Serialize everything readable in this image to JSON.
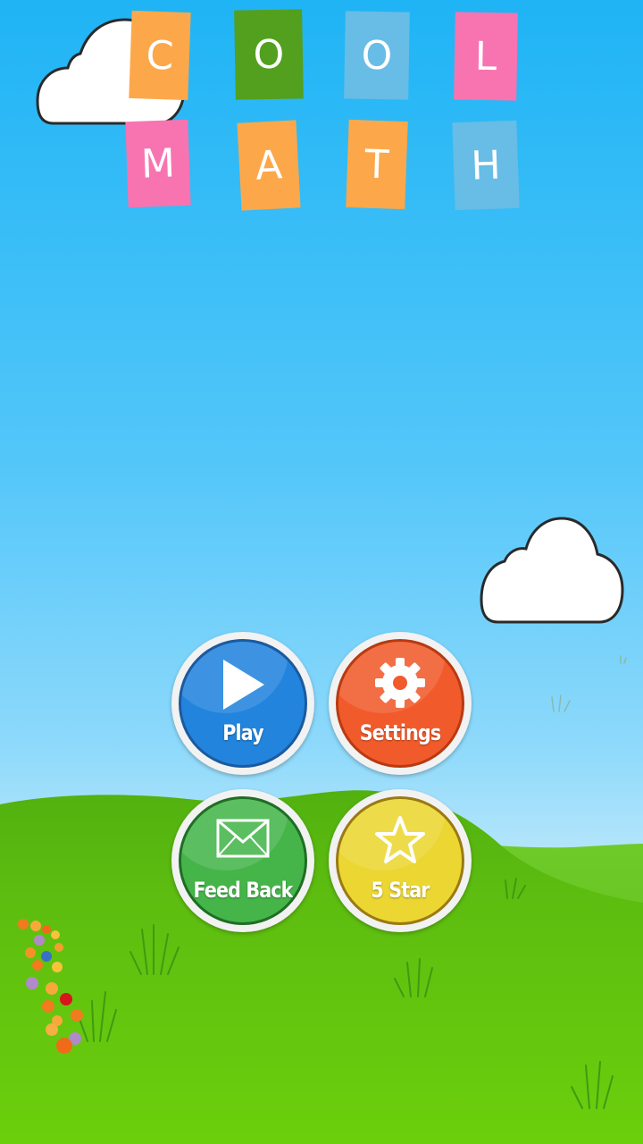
{
  "title": {
    "word1": [
      {
        "letter": "C",
        "color": "#fca84a"
      },
      {
        "letter": "O",
        "color": "#52a01e"
      },
      {
        "letter": "O",
        "color": "#67bde6"
      },
      {
        "letter": "L",
        "color": "#f774b1"
      }
    ],
    "word2": [
      {
        "letter": "M",
        "color": "#f774b1"
      },
      {
        "letter": "A",
        "color": "#fca84a"
      },
      {
        "letter": "T",
        "color": "#fca84a"
      },
      {
        "letter": "H",
        "color": "#67bde6"
      }
    ]
  },
  "menu": {
    "play": {
      "label": "Play",
      "icon": "play-icon",
      "color": "#2384dd"
    },
    "settings": {
      "label": "Settings",
      "icon": "gear-icon",
      "color": "#f15b2c"
    },
    "feedback": {
      "label": "Feed Back",
      "icon": "envelope-icon",
      "color": "#45b54a"
    },
    "rate": {
      "label": "5 Star",
      "icon": "star-icon",
      "color": "#ecd632"
    }
  },
  "colors": {
    "sky_top": "#1fb4f5",
    "sky_bottom": "#cdeefc",
    "grass": "#63c514"
  }
}
